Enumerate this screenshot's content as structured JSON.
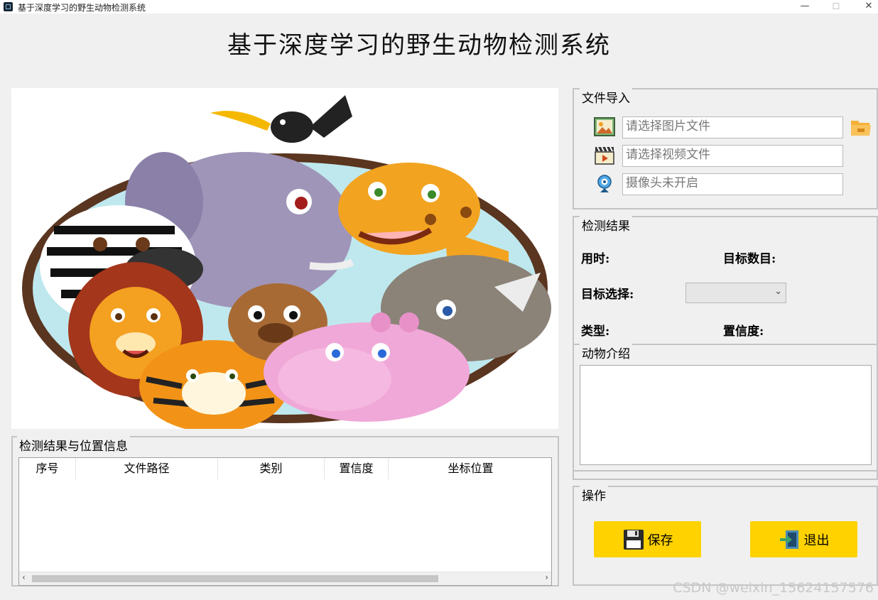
{
  "window": {
    "title": "基于深度学习的野生动物检测系统",
    "minimize": "—",
    "maximize": "☐",
    "close": "✕"
  },
  "header": {
    "title": "基于深度学习的野生动物检测系统"
  },
  "file_import": {
    "caption": "文件导入",
    "image_placeholder": "请选择图片文件",
    "video_placeholder": "请选择视频文件",
    "camera_status": "摄像头未开启"
  },
  "detection_result": {
    "caption": "检测结果",
    "time_label": "用时:",
    "count_label": "目标数目:",
    "target_select_label": "目标选择:",
    "type_label": "类型:",
    "confidence_label": "置信度:"
  },
  "animal_intro": {
    "caption": "动物介绍",
    "text": ""
  },
  "results_table": {
    "caption": "检测结果与位置信息",
    "columns": [
      "序号",
      "文件路径",
      "类别",
      "置信度",
      "坐标位置"
    ]
  },
  "operations": {
    "caption": "操作",
    "save_label": "保存",
    "exit_label": "退出"
  },
  "watermark": "CSDN @weixin_15624157576",
  "colors": {
    "button_yellow": "#ffd200",
    "background": "#f0f0f0",
    "group_border": "#c4c4c4"
  },
  "icons": [
    "image-file-icon",
    "video-file-icon",
    "camera-icon",
    "folder-open-icon",
    "save-disk-icon",
    "exit-door-icon"
  ]
}
